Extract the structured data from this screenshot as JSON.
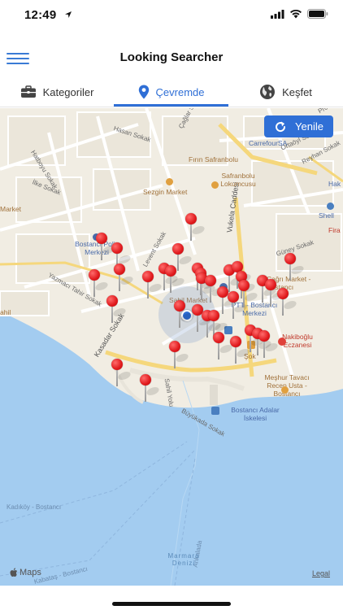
{
  "status_bar": {
    "time": "12:49"
  },
  "nav": {
    "title": "Looking Searcher"
  },
  "tabs": [
    {
      "label": "Kategoriler",
      "icon": "briefcase-icon",
      "active": false
    },
    {
      "label": "Çevremde",
      "icon": "location-pin-icon",
      "active": true
    },
    {
      "label": "Keşfet",
      "icon": "globe-icon",
      "active": false
    }
  ],
  "map": {
    "refresh_label": "Yenile",
    "attribution": "Maps",
    "legal": "Legal",
    "streets": [
      "Hatboyu Sokak",
      "İlke Sokak",
      "Hasan Sokak",
      "Çağlar Sokak",
      "Ortaöyl Sokak",
      "Reyhan Sokak",
      "Levent Sokak",
      "Vukela Caddesi",
      "Yazmacı Tahir Sokak",
      "Kasadar Sokak",
      "Güney Sokak",
      "Sahil Yolu",
      "Büyükada Sokak",
      "Ankalada",
      "Kadıköy - Bostancı",
      "Kabataş - Bostancı",
      "Pro"
    ],
    "pois": [
      "CarrefourSA",
      "Fırın Safranbolu",
      "Safranbolu Lokumcusu",
      "Sezgin Market",
      "Shell",
      "Bostancı Polis Merkezi",
      "PTT - Bostancı Merkezi",
      "Sahil Market",
      "Çağrı Market - Bostancı",
      "Nakiboğlu Eczanesi",
      "Şok",
      "Meşhur Tavacı Recep Usta - Bostancı",
      "Bostancı Adalar İskelesi",
      "Market",
      "Hak",
      "Fira",
      "ahil"
    ],
    "sea_label": "Marmara Denizi",
    "pin_count": 36
  },
  "colors": {
    "accent": "#2f6fd6",
    "pin": "#e0191c",
    "sea": "#a3ccf0",
    "land": "#f1ede3"
  }
}
